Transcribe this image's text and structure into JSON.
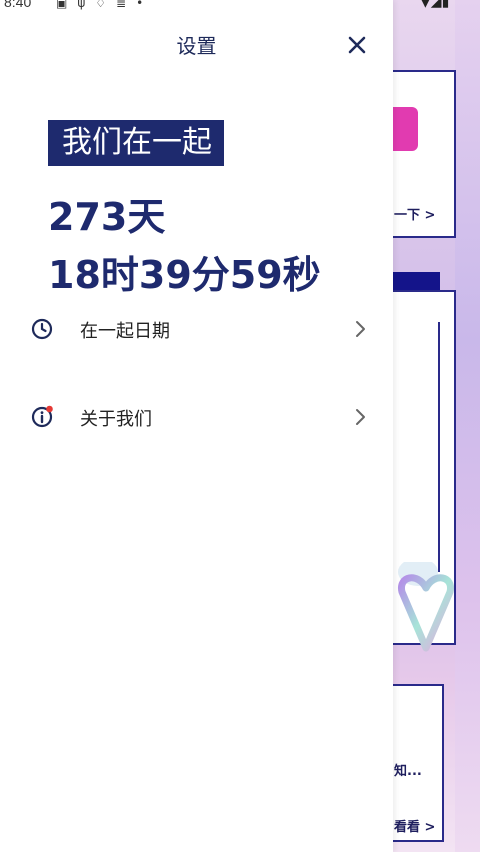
{
  "status_bar": {
    "time": "8:40",
    "left_icons": [
      "notification-icon",
      "usb-icon",
      "bell-icon",
      "clipboard-icon",
      "dot-icon"
    ],
    "right_icons": [
      "wifi-icon",
      "signal-icon",
      "battery-icon"
    ]
  },
  "drawer": {
    "title": "设置",
    "close_icon": "close-icon",
    "badge_label": "我们在一起",
    "days": "273天",
    "time_elapsed": "18时39分59秒",
    "menu": [
      {
        "icon": "clock-icon",
        "label": "在一起日期"
      },
      {
        "icon": "info-icon",
        "label": "关于我们",
        "has_notification_dot": true
      }
    ]
  },
  "background_app": {
    "button_text": "一下 >",
    "card_text": "知...",
    "link_text": "看看 >"
  },
  "colors": {
    "accent": "#1e2a6e",
    "pink": "#e13bb0",
    "notification_dot": "#e53935"
  }
}
